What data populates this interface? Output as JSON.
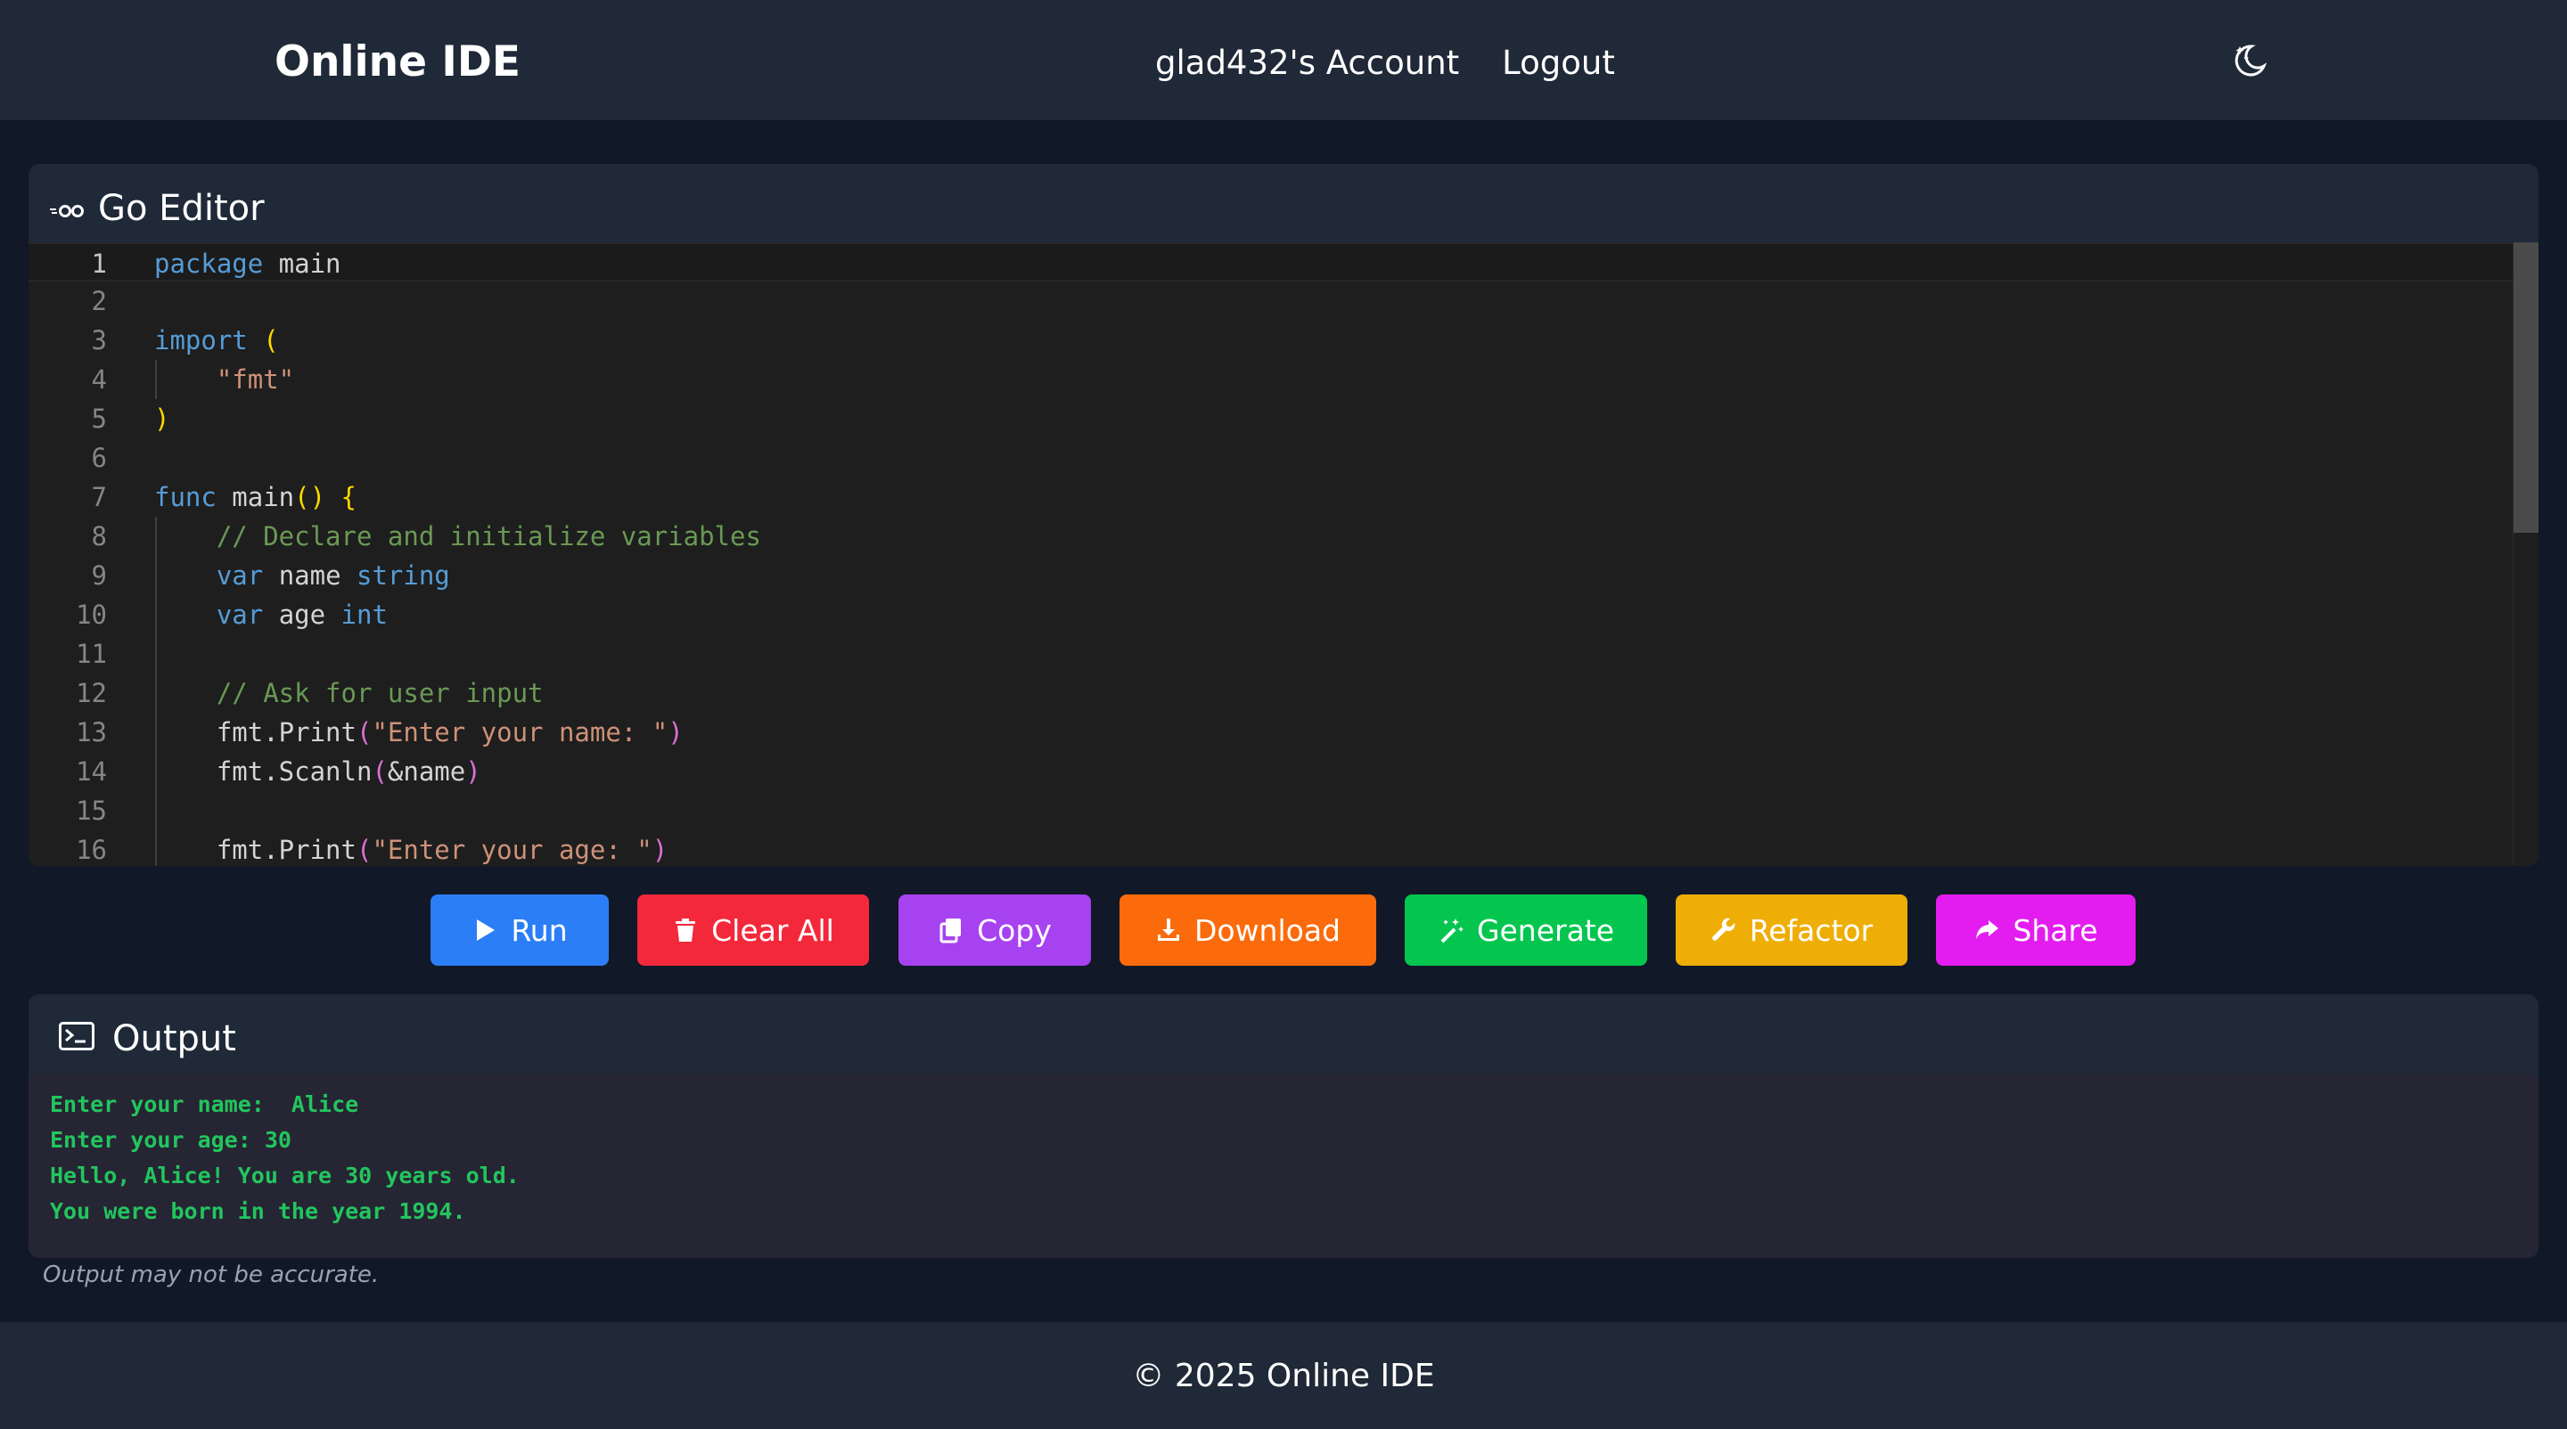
{
  "header": {
    "brand": "Online IDE",
    "account_link": "glad432's Account",
    "logout_link": "Logout",
    "theme_icon": "moon-stars-icon"
  },
  "editor": {
    "title": "Go Editor",
    "language_icon": "go-logo-icon",
    "lines": [
      {
        "n": "1",
        "tokens": [
          [
            "kw",
            "package"
          ],
          [
            "id",
            " main"
          ]
        ]
      },
      {
        "n": "2",
        "tokens": []
      },
      {
        "n": "3",
        "tokens": [
          [
            "kw",
            "import"
          ],
          [
            "id",
            " "
          ],
          [
            "br1",
            "("
          ]
        ]
      },
      {
        "n": "4",
        "tokens": [
          [
            "id",
            "    "
          ],
          [
            "str",
            "\"fmt\""
          ]
        ]
      },
      {
        "n": "5",
        "tokens": [
          [
            "br1",
            ")"
          ]
        ]
      },
      {
        "n": "6",
        "tokens": []
      },
      {
        "n": "7",
        "tokens": [
          [
            "kw",
            "func"
          ],
          [
            "id",
            " main"
          ],
          [
            "br1",
            "()"
          ],
          [
            "id",
            " "
          ],
          [
            "br1",
            "{"
          ]
        ]
      },
      {
        "n": "8",
        "tokens": [
          [
            "id",
            "    "
          ],
          [
            "cmt",
            "// Declare and initialize variables"
          ]
        ]
      },
      {
        "n": "9",
        "tokens": [
          [
            "id",
            "    "
          ],
          [
            "kw",
            "var"
          ],
          [
            "id",
            " name "
          ],
          [
            "kw",
            "string"
          ]
        ]
      },
      {
        "n": "10",
        "tokens": [
          [
            "id",
            "    "
          ],
          [
            "kw",
            "var"
          ],
          [
            "id",
            " age "
          ],
          [
            "kw",
            "int"
          ]
        ]
      },
      {
        "n": "11",
        "tokens": []
      },
      {
        "n": "12",
        "tokens": [
          [
            "id",
            "    "
          ],
          [
            "cmt",
            "// Ask for user input"
          ]
        ]
      },
      {
        "n": "13",
        "tokens": [
          [
            "id",
            "    fmt.Print"
          ],
          [
            "br2",
            "("
          ],
          [
            "str",
            "\"Enter your name: \""
          ],
          [
            "br2",
            ")"
          ]
        ]
      },
      {
        "n": "14",
        "tokens": [
          [
            "id",
            "    fmt.Scanln"
          ],
          [
            "br2",
            "("
          ],
          [
            "id",
            "&name"
          ],
          [
            "br2",
            ")"
          ]
        ]
      },
      {
        "n": "15",
        "tokens": []
      },
      {
        "n": "16",
        "tokens": [
          [
            "id",
            "    fmt.Print"
          ],
          [
            "br2",
            "("
          ],
          [
            "str",
            "\"Enter your age: \""
          ],
          [
            "br2",
            ")"
          ]
        ]
      }
    ]
  },
  "toolbar": {
    "buttons": [
      {
        "label": "Run",
        "icon": "play-icon",
        "color": "#2b7ef5"
      },
      {
        "label": "Clear All",
        "icon": "trash-icon",
        "color": "#f4283b"
      },
      {
        "label": "Copy",
        "icon": "copy-icon",
        "color": "#a742f0"
      },
      {
        "label": "Download",
        "icon": "download-icon",
        "color": "#fb6b0b"
      },
      {
        "label": "Generate",
        "icon": "magic-wand-icon",
        "color": "#04c64f"
      },
      {
        "label": "Refactor",
        "icon": "wrench-icon",
        "color": "#eeae06"
      },
      {
        "label": "Share",
        "icon": "share-icon",
        "color": "#e31cf0"
      }
    ]
  },
  "output": {
    "title": "Output",
    "icon": "terminal-icon",
    "lines": [
      "Enter your name:  Alice",
      "Enter your age: 30",
      "Hello, Alice! You are 30 years old.",
      "You were born in the year 1994."
    ],
    "disclaimer": "Output may not be accurate."
  },
  "footer": {
    "text": "© 2025 Online IDE"
  }
}
